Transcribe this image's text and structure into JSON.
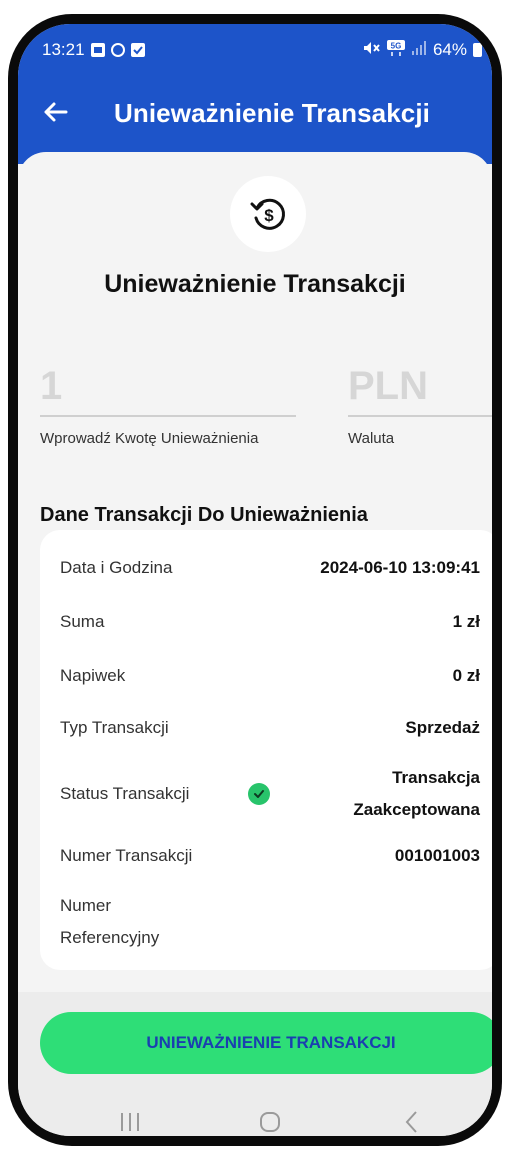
{
  "status_bar": {
    "time": "13:21",
    "battery": "64%"
  },
  "header": {
    "title": "Unieważnienie Transakcji"
  },
  "main": {
    "heading": "Unieważnienie Transakcji",
    "amount": {
      "value": "1",
      "label": "Wprowadź Kwotę Unieważnienia"
    },
    "currency": {
      "value": "PLN",
      "label": "Waluta"
    },
    "section_title": "Dane Transakcji Do Unieważnienia",
    "details": [
      {
        "label": "Data i Godzina",
        "value": "2024-06-10 13:09:41"
      },
      {
        "label": "Suma",
        "value": "1 zł"
      },
      {
        "label": "Napiwek",
        "value": "0 zł"
      },
      {
        "label": "Typ Transakcji",
        "value": "Sprzedaż"
      },
      {
        "label": "Status Transakcji",
        "value_line1": "Transakcja",
        "value_line2": "Zaakceptowana"
      },
      {
        "label": "Numer Transakcji",
        "value": "001001003"
      },
      {
        "label_line1": "Numer",
        "label_line2": "Referencyjny"
      }
    ],
    "action_button": "UNIEWAŻNIENIE TRANSAKCJI"
  },
  "colors": {
    "header_bg": "#1d54c9",
    "button_bg": "#2ede77",
    "button_text": "#1a3fb0",
    "success": "#28c46b"
  },
  "icons": [
    "image-icon",
    "instagram-icon",
    "check-square-icon",
    "mute-icon",
    "5g-icon",
    "signal-icon",
    "battery-icon",
    "back-arrow-icon",
    "refund-dollar-icon",
    "check-circle-icon",
    "recent-apps-icon",
    "home-icon",
    "nav-back-icon"
  ]
}
